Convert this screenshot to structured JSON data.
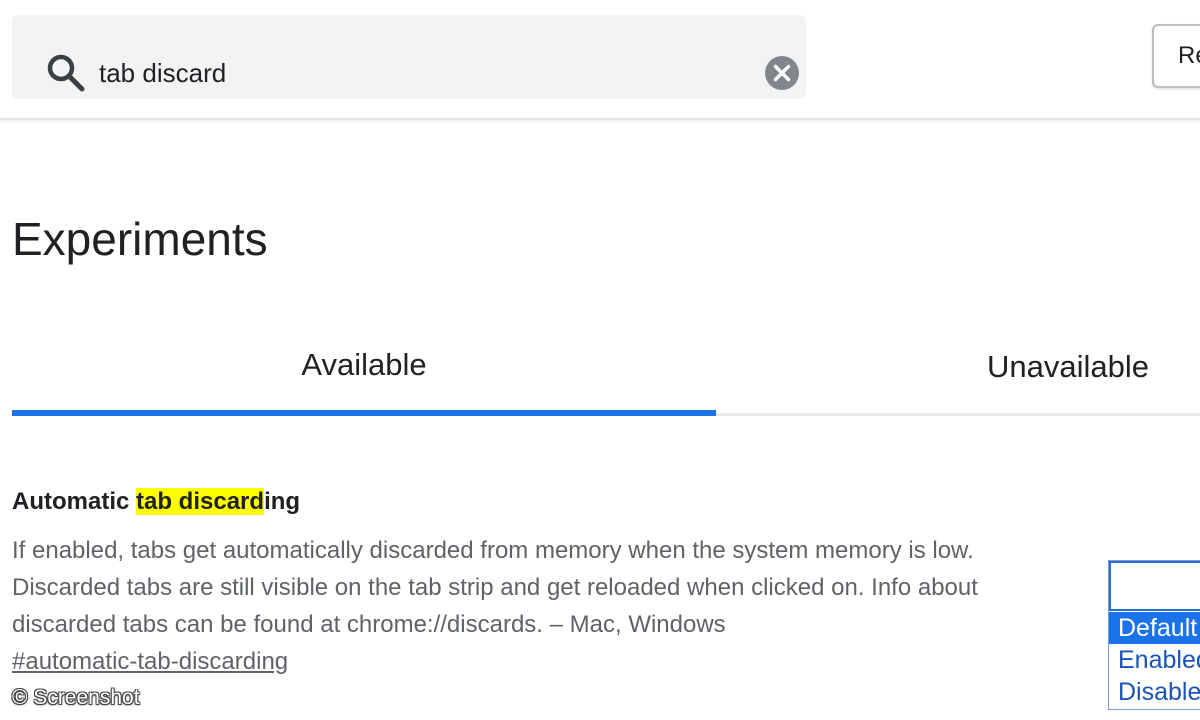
{
  "search": {
    "value": "tab discard",
    "search_icon": "search-icon",
    "clear_icon": "clear-icon"
  },
  "header": {
    "reset_button_label": "Re"
  },
  "page": {
    "title": "Experiments"
  },
  "tabs": [
    {
      "label": "Available",
      "selected": true
    },
    {
      "label": "Unavailable",
      "selected": false
    }
  ],
  "experiment": {
    "title_prefix": "Automatic ",
    "title_highlight": "tab discard",
    "title_suffix": "ing",
    "description": "If enabled, tabs get automatically discarded from memory when the system memory is low. Discarded tabs are still visible on the tab strip and get reloaded when clicked on. Info about discarded tabs can be found at chrome://discards. – Mac, Windows",
    "link": "#automatic-tab-discarding",
    "options": [
      "Default",
      "Enabled",
      "Disabled"
    ],
    "selected_option": "Default"
  },
  "watermark": "© Screenshot",
  "colors": {
    "accent": "#1a73e8",
    "highlight": "#ffff00",
    "search_bg": "#f1f3f4",
    "muted_text": "#5f6368"
  }
}
